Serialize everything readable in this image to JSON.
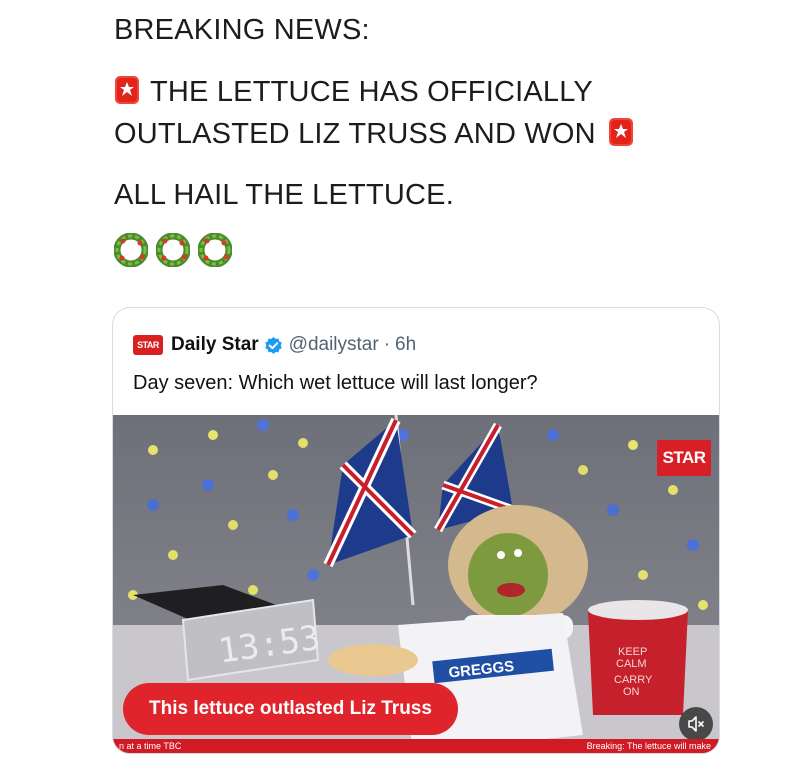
{
  "post": {
    "line1": "BREAKING NEWS:",
    "line2": "THE LETTUCE HAS OFFICIALLY",
    "line3": "OUTLASTED LIZ TRUSS AND WON",
    "line4": "ALL HAIL THE LETTUCE.",
    "leading_emoji": "siren-icon",
    "trailing_emoji": "siren-icon",
    "lettuce_emojis": [
      "wreath-icon",
      "wreath-icon",
      "wreath-icon"
    ]
  },
  "quoted_tweet": {
    "logo_text": "STAR",
    "account_name": "Daily Star",
    "handle": "@dailystar",
    "separator": "·",
    "time": "6h",
    "text": "Day seven: Which wet lettuce will last longer?",
    "media": {
      "badge": "STAR",
      "caption": "This lettuce outlasted Liz Truss",
      "ticker_left": "n at a time TBC",
      "ticker_right": "Breaking: The lettuce will make",
      "clock": "13:53",
      "bag_label": "GREGGS",
      "mug_text": [
        "KEEP",
        "CALM",
        "CARRY",
        "ON"
      ]
    }
  },
  "colors": {
    "brand_red": "#e0242b",
    "verified_blue": "#1d9bf0",
    "text": "#1c1c1c",
    "muted": "#536471"
  }
}
